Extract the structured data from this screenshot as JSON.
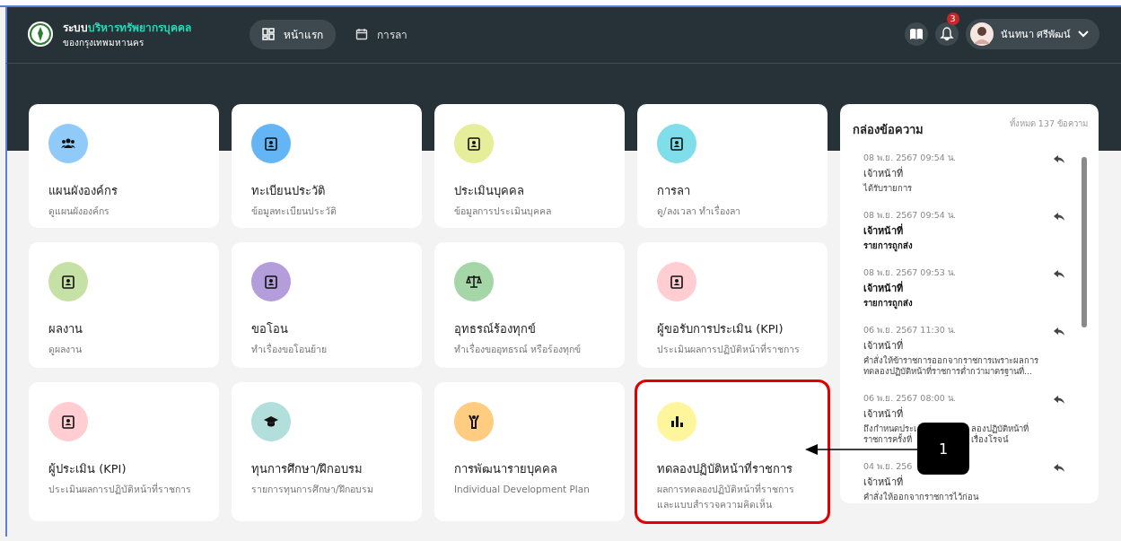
{
  "header": {
    "title_prefix": "ระบบ",
    "title_highlight": "บริหารทรัพยากรบุคคล",
    "subtitle": "ของกรุงเทพมหานคร",
    "nav": [
      {
        "label": "หน้าแรก",
        "selected": true
      },
      {
        "label": "การลา",
        "selected": false
      }
    ],
    "notification_count": "3",
    "user_name": "นันทนา ศรีพัฒน์"
  },
  "cards": [
    {
      "title": "แผนผังองค์กร",
      "subtitle": "ดูแผนผังองค์กร",
      "color": "#90caf9",
      "highlighted": false
    },
    {
      "title": "ทะเบียนประวัติ",
      "subtitle": "ข้อมูลทะเบียนประวัติ",
      "color": "#64b5f6",
      "highlighted": false
    },
    {
      "title": "ประเมินบุคคล",
      "subtitle": "ข้อมูลการประเมินบุคคล",
      "color": "#e6ee9c",
      "highlighted": false
    },
    {
      "title": "การลา",
      "subtitle": "ดู/ลงเวลา ทำเรื่องลา",
      "color": "#80deea",
      "highlighted": false
    },
    {
      "title": "ผลงาน",
      "subtitle": "ดูผลงาน",
      "color": "#c5e1a5",
      "highlighted": false
    },
    {
      "title": "ขอโอน",
      "subtitle": "ทำเรื่องขอโอนย้าย",
      "color": "#b39ddb",
      "highlighted": false
    },
    {
      "title": "อุทธรณ์ร้องทุกข์",
      "subtitle": "ทำเรื่องขออุทธรณ์ หรือร้องทุกข์",
      "color": "#a5d6a7",
      "highlighted": false
    },
    {
      "title": "ผู้ขอรับการประเมิน (KPI)",
      "subtitle": "ประเมินผลการปฏิบัติหน้าที่ราชการ",
      "color": "#ffcdd2",
      "highlighted": false
    },
    {
      "title": "ผู้ประเมิน (KPI)",
      "subtitle": "ประเมินผลการปฏิบัติหน้าที่ราชการ",
      "color": "#ffcdd2",
      "highlighted": false
    },
    {
      "title": "ทุนการศึกษา/ฝึกอบรม",
      "subtitle": "รายการทุนการศึกษา/ฝึกอบรม",
      "color": "#b2dfdb",
      "highlighted": false
    },
    {
      "title": "การพัฒนารายบุคคล",
      "subtitle": "Individual Development Plan",
      "color": "#ffcc80",
      "highlighted": false
    },
    {
      "title": "ทดลองปฏิบัติหน้าที่ราชการ",
      "subtitle": "ผลการทดลองปฏิบัติหน้าที่ราชการและแบบสำรวจความคิดเห็น",
      "color": "#fff59d",
      "highlighted": true
    }
  ],
  "inbox": {
    "title": "กล่องข้อความ",
    "total": "ทั้งหมด 137 ข้อความ",
    "messages": [
      {
        "date": "08 พ.ย. 2567 09:54 น.",
        "sender": "เจ้าหน้าที่",
        "body": "ได้รับรายการ",
        "unread": false
      },
      {
        "date": "08 พ.ย. 2567 09:54 น.",
        "sender": "เจ้าหน้าที่",
        "body": "รายการถูกส่ง",
        "unread": true
      },
      {
        "date": "08 พ.ย. 2567 09:53 น.",
        "sender": "เจ้าหน้าที่",
        "body": "รายการถูกส่ง",
        "unread": true
      },
      {
        "date": "06 พ.ย. 2567 11:30 น.",
        "sender": "เจ้าหน้าที่",
        "body": "คำสั่งให้ข้าราชการออกจากราชการเพราะผลการทดลองปฏิบัติหน้าที่ราชการต่ำกว่ามาตรฐานที่...",
        "unread": false
      },
      {
        "date": "06 พ.ย. 2567 08:00 น.",
        "sender": "เจ้าหน้าที่",
        "body_lines": [
          [
            "ถึงกำหนดประเ",
            "ลองปฏิบัติหน้าที่"
          ],
          [
            "ราชการครั้งที่",
            "เรื่องโรจน์"
          ]
        ],
        "unread": false
      },
      {
        "date": "04 พ.ย. 256",
        "sender": "เจ้าหน้าที่",
        "body": "คำสั่งให้ออกจากราชการไว้ก่อน",
        "unread": false
      }
    ]
  },
  "callout": {
    "label": "1"
  }
}
